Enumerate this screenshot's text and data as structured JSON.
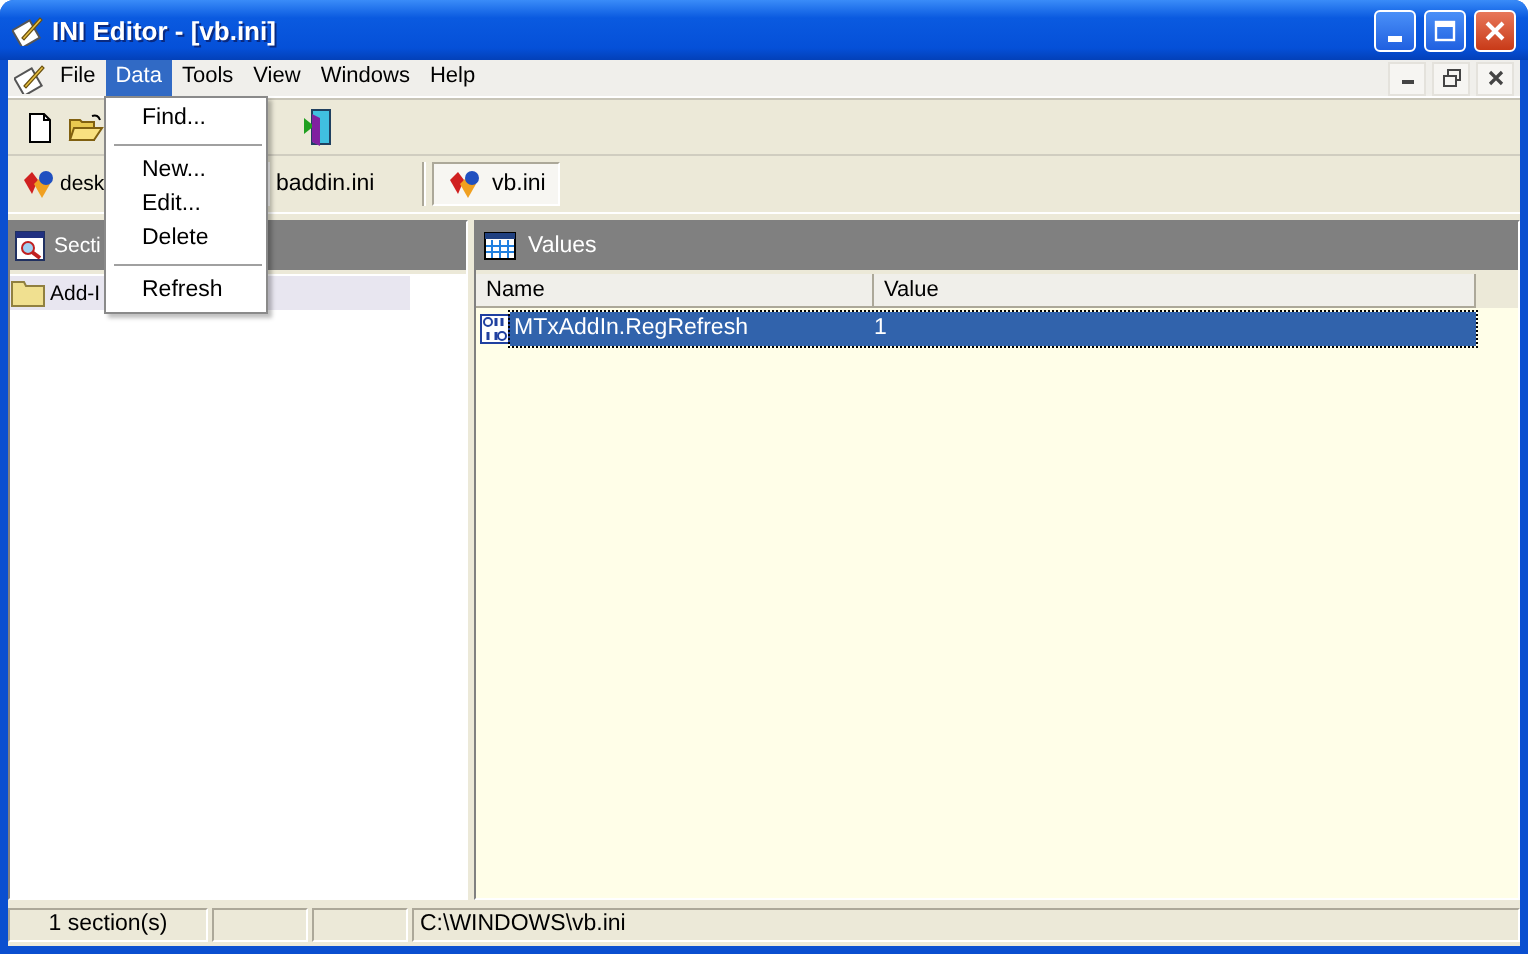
{
  "window": {
    "title": "INI Editor - [vb.ini]"
  },
  "menu_bar": {
    "items": [
      {
        "label": "File",
        "selected": false
      },
      {
        "label": "Data",
        "selected": true
      },
      {
        "label": "Tools",
        "selected": false
      },
      {
        "label": "View",
        "selected": false
      },
      {
        "label": "Windows",
        "selected": false
      },
      {
        "label": "Help",
        "selected": false
      }
    ]
  },
  "open_menu": {
    "items": [
      {
        "kind": "item",
        "label": "Find..."
      },
      {
        "kind": "separator"
      },
      {
        "kind": "item",
        "label": "New..."
      },
      {
        "kind": "item",
        "label": "Edit..."
      },
      {
        "kind": "item",
        "label": "Delete"
      },
      {
        "kind": "separator"
      },
      {
        "kind": "item",
        "label": "Refresh"
      }
    ]
  },
  "file_tabs": [
    {
      "label": "desk",
      "selected": false
    },
    {
      "label": "baddin.ini",
      "selected": false
    },
    {
      "label": "vb.ini",
      "selected": true
    }
  ],
  "sections_panel": {
    "title": "Secti",
    "items": [
      {
        "label": "Add-I",
        "selected": true
      }
    ]
  },
  "values_panel": {
    "title": "Values",
    "columns": [
      "Name",
      "Value"
    ],
    "rows": [
      {
        "name": "MTxAddIn.RegRefresh",
        "value": "1",
        "selected": true
      }
    ]
  },
  "status_bar": {
    "sections": "1 section(s)",
    "path": "C:\\WINDOWS\\vb.ini"
  }
}
